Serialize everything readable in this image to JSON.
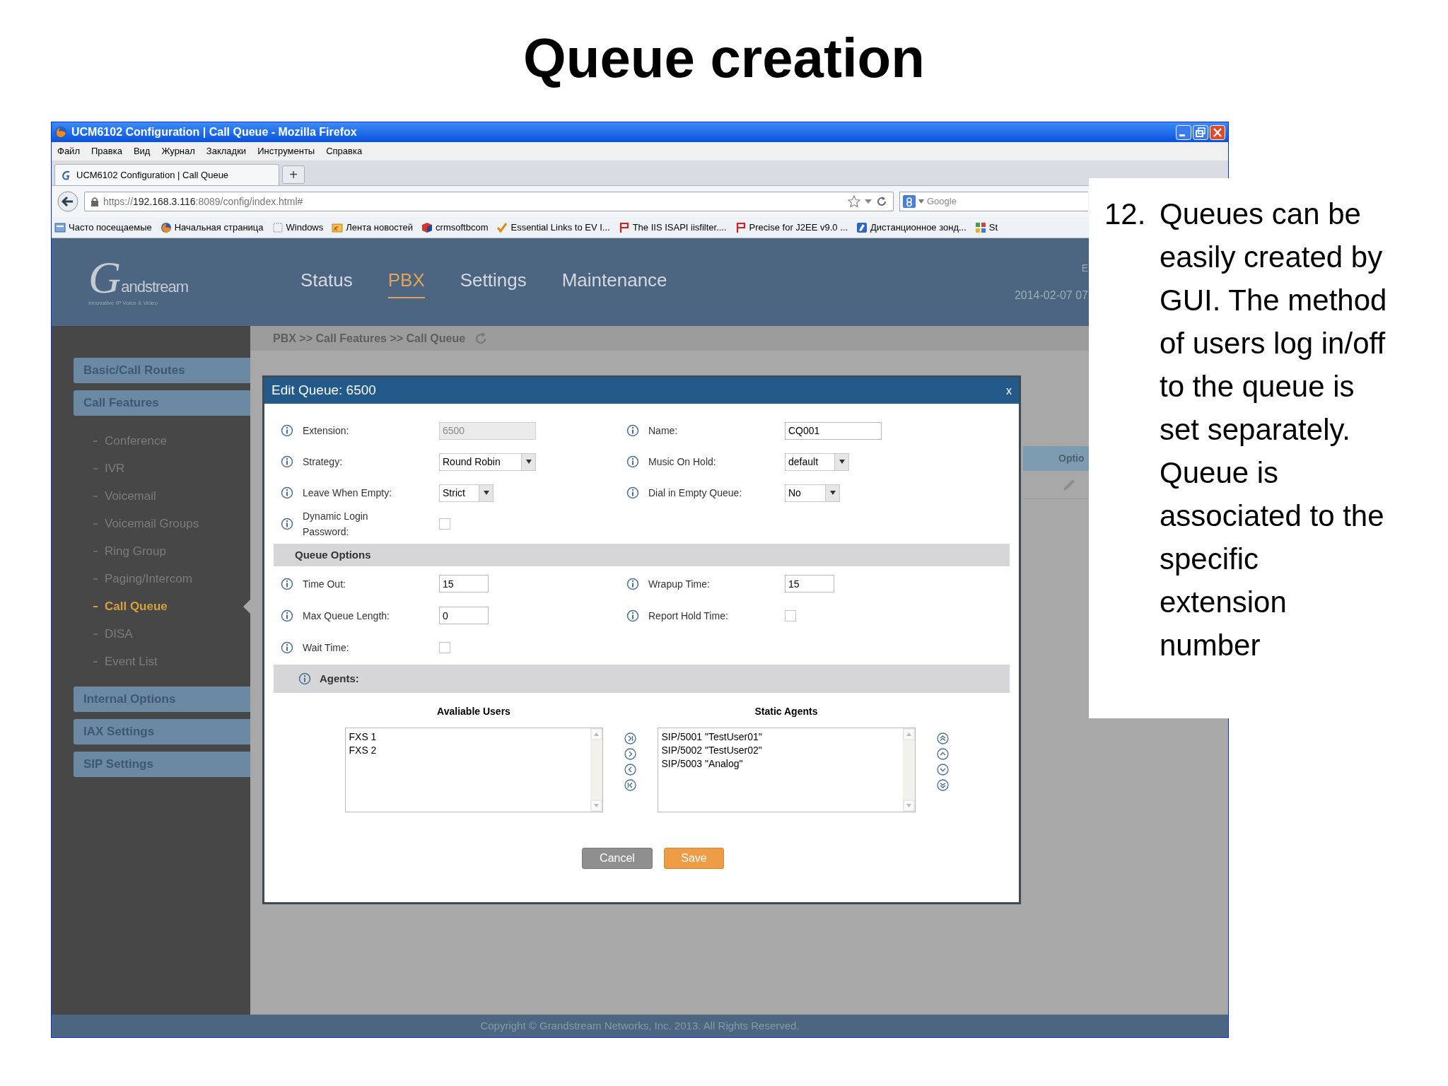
{
  "slide": {
    "title": "Queue creation"
  },
  "browser": {
    "title": "UCM6102 Configuration | Call Queue - Mozilla Firefox",
    "menu": [
      "Файл",
      "Правка",
      "Вид",
      "Журнал",
      "Закладки",
      "Инструменты",
      "Справка"
    ],
    "tab": {
      "label": "UCM6102 Configuration | Call Queue"
    },
    "new_tab": "+",
    "address": {
      "scheme": "https://",
      "host": "192.168.3.116",
      "rest": ":8089/config/index.html#"
    },
    "search": {
      "placeholder": "Google"
    },
    "bookmarks": [
      {
        "label": "Часто посещаемые",
        "kind": "page"
      },
      {
        "label": "Начальная страница",
        "kind": "globe"
      },
      {
        "label": "Windows",
        "kind": "blank"
      },
      {
        "label": "Лента новостей",
        "kind": "feed"
      },
      {
        "label": "crmsoftbcom",
        "kind": "cube"
      },
      {
        "label": "Essential Links to EV I...",
        "kind": "check"
      },
      {
        "label": "The IIS ISAPI iisfilter....",
        "kind": "flag"
      },
      {
        "label": "Precise for J2EE v9.0 ...",
        "kind": "flag"
      },
      {
        "label": "Дистанционное зонд...",
        "kind": "app"
      },
      {
        "label": "St",
        "kind": "puzzle"
      }
    ]
  },
  "app": {
    "logo": {
      "initial": "G",
      "wordmark": "andstream",
      "tagline": "Innovative IP Voice & Video"
    },
    "nav": [
      {
        "label": "Status",
        "selected": false
      },
      {
        "label": "PBX",
        "selected": true
      },
      {
        "label": "Settings",
        "selected": false
      },
      {
        "label": "Maintenance",
        "selected": false
      }
    ],
    "corner": "E",
    "date": "2014-02-07 07",
    "sidebar": [
      {
        "label": "Basic/Call Routes"
      },
      {
        "label": "Call Features",
        "children": [
          {
            "label": "Conference",
            "selected": false
          },
          {
            "label": "IVR",
            "selected": false
          },
          {
            "label": "Voicemail",
            "selected": false
          },
          {
            "label": "Voicemail Groups",
            "selected": false
          },
          {
            "label": "Ring Group",
            "selected": false
          },
          {
            "label": "Paging/Intercom",
            "selected": false
          },
          {
            "label": "Call Queue",
            "selected": true
          },
          {
            "label": "DISA",
            "selected": false
          },
          {
            "label": "Event List",
            "selected": false
          }
        ]
      },
      {
        "label": "Internal Options"
      },
      {
        "label": "IAX Settings"
      },
      {
        "label": "SIP Settings"
      }
    ],
    "breadcrumb": "PBX >> Call Features >> Call Queue",
    "table": {
      "columns": [
        "Optio"
      ]
    },
    "footer": "Copyright © Grandstream Networks, Inc. 2013. All Rights Reserved."
  },
  "dialog": {
    "title": "Edit Queue: 6500",
    "close": "x",
    "fields": [
      {
        "label": "Extension:",
        "kind": "text",
        "value": "6500",
        "disabled": true
      },
      {
        "label": "Name:",
        "kind": "text",
        "value": "CQ001",
        "disabled": false
      },
      {
        "label": "Strategy:",
        "kind": "select",
        "value": "Round Robin"
      },
      {
        "label": "Music On Hold:",
        "kind": "select",
        "value": "default"
      },
      {
        "label": "Leave When Empty:",
        "kind": "select",
        "value": "Strict"
      },
      {
        "label": "Dial in Empty Queue:",
        "kind": "select",
        "value": "No"
      },
      {
        "label": "Dynamic Login Password:",
        "kind": "checkbox",
        "checked": false
      }
    ],
    "queue_options": {
      "title": "Queue Options",
      "fields": [
        {
          "label": "Time Out:",
          "kind": "text",
          "value": "15",
          "disabled": false
        },
        {
          "label": "Wrapup Time:",
          "kind": "text",
          "value": "15",
          "disabled": false
        },
        {
          "label": "Max Queue Length:",
          "kind": "text",
          "value": "0",
          "disabled": false
        },
        {
          "label": "Report Hold Time:",
          "kind": "checkbox",
          "checked": false
        },
        {
          "label": "Wait Time:",
          "kind": "checkbox",
          "checked": false
        }
      ]
    },
    "agents": {
      "title": "Agents:",
      "available": {
        "heading": "Avaliable Users",
        "items": [
          "FXS 1",
          "FXS 2"
        ]
      },
      "static": {
        "heading": "Static Agents",
        "items": [
          "SIP/5001 \"TestUser01\"",
          "SIP/5002 \"TestUser02\"",
          "SIP/5003 \"Analog\""
        ]
      }
    },
    "buttons": [
      {
        "label": "Cancel",
        "kind": "cancel"
      },
      {
        "label": "Save",
        "kind": "save"
      }
    ]
  },
  "note": {
    "number": "12.",
    "text": "Queues can be easily created by GUI. The method of users log in/off to the queue is set separately. Queue is associated to the specific extension number"
  }
}
